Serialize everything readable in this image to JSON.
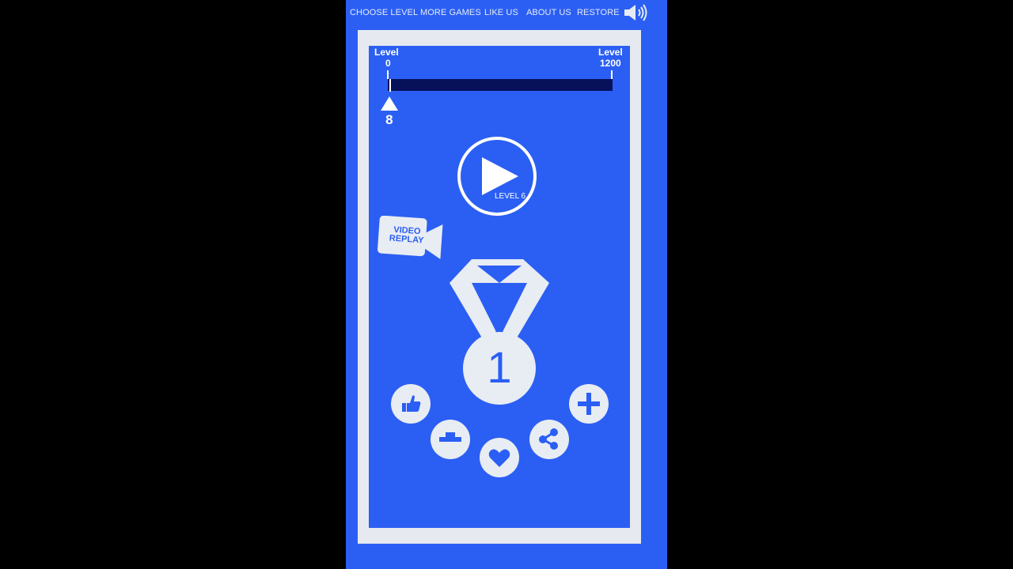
{
  "nav": {
    "choose_level": "CHOOSE LEVEL",
    "more_games": "MORE GAMES",
    "like_us": "LIKE US",
    "about_us": "ABOUT US",
    "restore": "RESTORE",
    "sound_icon": "speaker-icon"
  },
  "progress": {
    "left_label": "Level",
    "left_value": "0",
    "right_label": "Level",
    "right_value": "1200",
    "current": "8",
    "fraction": 0.0067
  },
  "play": {
    "level_label": "LEVEL 6"
  },
  "video_replay": {
    "line1": "VIDEO",
    "line2": "REPLAY"
  },
  "medal": {
    "rank": "1"
  },
  "icons": {
    "like": "thumbs-up-icon",
    "leaderboard": "podium-icon",
    "favorite": "heart-icon",
    "share": "share-icon",
    "more": "plus-icon"
  },
  "colors": {
    "background": "#2b5ff3",
    "frame": "#e6e9ef",
    "progress_track": "#07115a",
    "white": "#ffffff"
  }
}
